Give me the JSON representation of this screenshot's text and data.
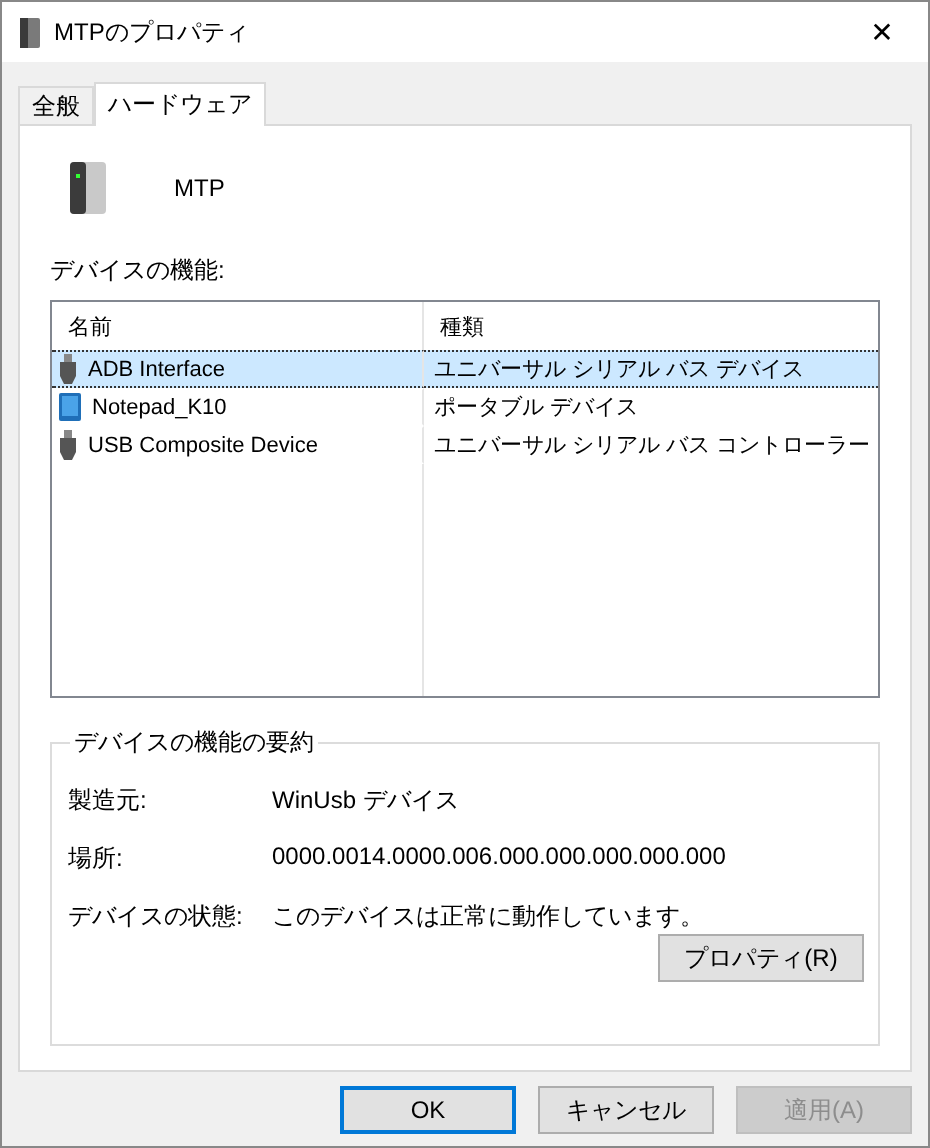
{
  "window": {
    "title": "MTPのプロパティ",
    "close": "✕"
  },
  "tabs": [
    {
      "label": "全般",
      "selected": false
    },
    {
      "label": "ハードウェア",
      "selected": true
    }
  ],
  "device": {
    "name": "MTP"
  },
  "functions": {
    "label": "デバイスの機能:",
    "columns": [
      "名前",
      "種類"
    ],
    "rows": [
      {
        "name": "ADB Interface",
        "type": "ユニバーサル シリアル バス デバイス",
        "kind": "usb",
        "selected": true
      },
      {
        "name": "Notepad_K10",
        "type": "ポータブル デバイス",
        "kind": "portable",
        "selected": false
      },
      {
        "name": "USB Composite Device",
        "type": "ユニバーサル シリアル バス コントローラー",
        "kind": "usb",
        "selected": false
      }
    ]
  },
  "summary": {
    "title": "デバイスの機能の要約",
    "fields": [
      {
        "label": "製造元:",
        "value": "WinUsb デバイス"
      },
      {
        "label": "場所:",
        "value": "0000.0014.0000.006.000.000.000.000.000"
      },
      {
        "label": "デバイスの状態:",
        "value": "このデバイスは正常に動作しています。"
      }
    ],
    "button": "プロパティ(R)"
  },
  "buttons": [
    {
      "label": "OK",
      "default": true,
      "disabled": false
    },
    {
      "label": "キャンセル",
      "default": false,
      "disabled": false
    },
    {
      "label": "適用(A)",
      "default": false,
      "disabled": true
    }
  ]
}
